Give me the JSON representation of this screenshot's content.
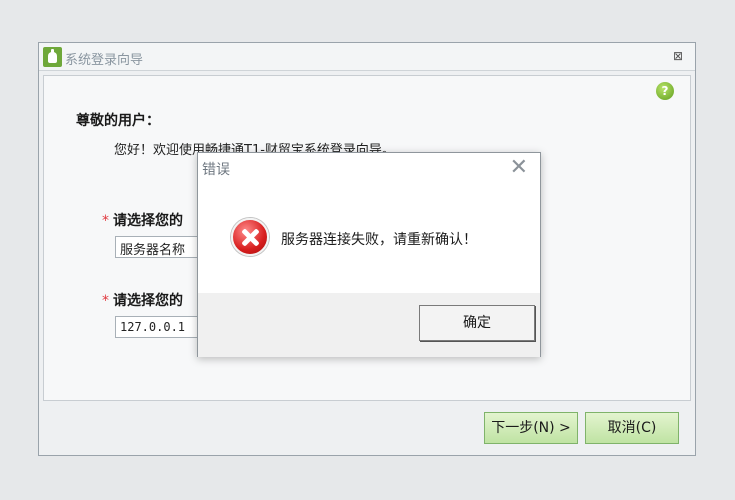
{
  "wizard": {
    "title": "系统登录向导",
    "close_glyph": "⊠",
    "help_glyph": "?",
    "greeting": "尊敬的用户：",
    "intro": "您好！欢迎使用畅捷通T1-财贸宝系统登录向导。",
    "required_mark": "*",
    "field1_label": "请选择您的",
    "field1_value": "服务器名称",
    "field2_label": "请选择您的",
    "field2_value": "127.0.0.1",
    "next_button": "下一步(N) >",
    "cancel_button": "取消(C)"
  },
  "error_dialog": {
    "title": "错误",
    "close_glyph": "✕",
    "message": "服务器连接失败，请重新确认！",
    "ok_button": "确定"
  },
  "colors": {
    "accent_green": "#6fa83a",
    "error_red": "#d81e1e",
    "required_red": "#e0383e"
  },
  "icons": [
    "app-icon",
    "close-icon",
    "help-icon",
    "error-icon"
  ]
}
